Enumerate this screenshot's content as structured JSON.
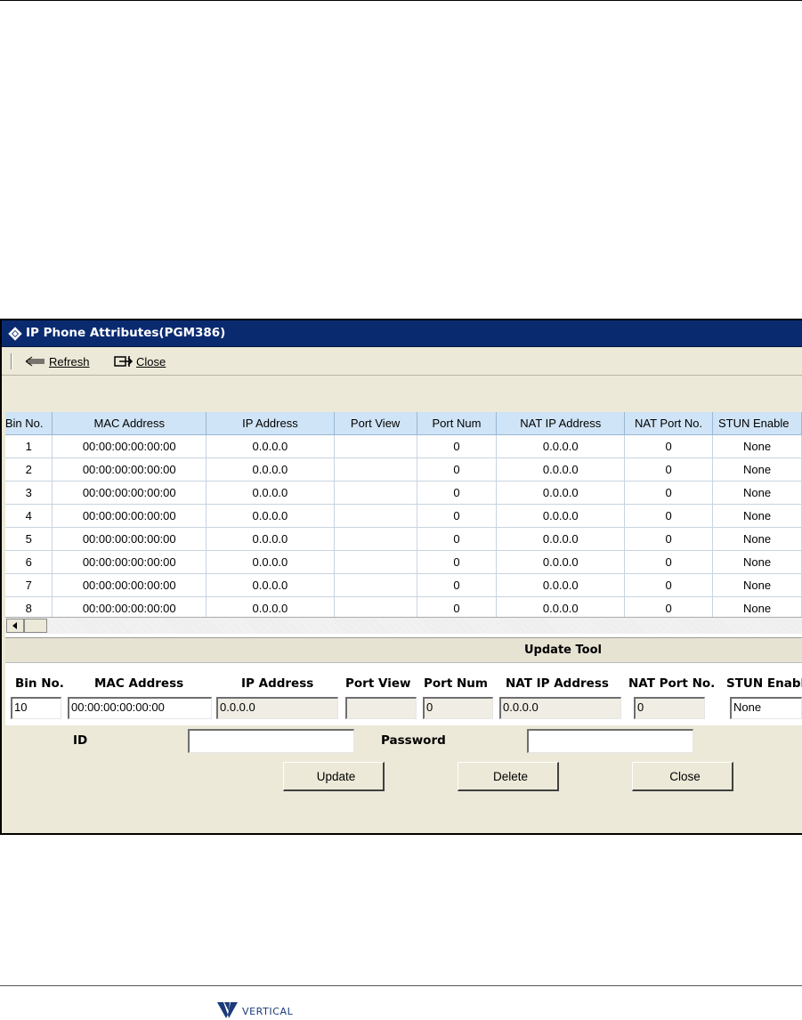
{
  "window": {
    "title": "IP Phone Attributes(PGM386)"
  },
  "toolbar": {
    "refresh_label": "Refresh",
    "close_label": "Close"
  },
  "table": {
    "columns": [
      "Bin No.",
      "MAC Address",
      "IP Address",
      "Port View",
      "Port Num",
      "NAT IP Address",
      "NAT Port No.",
      "STUN Enable"
    ],
    "rows": [
      [
        "1",
        "00:00:00:00:00:00",
        "0.0.0.0",
        "",
        "0",
        "0.0.0.0",
        "0",
        "None"
      ],
      [
        "2",
        "00:00:00:00:00:00",
        "0.0.0.0",
        "",
        "0",
        "0.0.0.0",
        "0",
        "None"
      ],
      [
        "3",
        "00:00:00:00:00:00",
        "0.0.0.0",
        "",
        "0",
        "0.0.0.0",
        "0",
        "None"
      ],
      [
        "4",
        "00:00:00:00:00:00",
        "0.0.0.0",
        "",
        "0",
        "0.0.0.0",
        "0",
        "None"
      ],
      [
        "5",
        "00:00:00:00:00:00",
        "0.0.0.0",
        "",
        "0",
        "0.0.0.0",
        "0",
        "None"
      ],
      [
        "6",
        "00:00:00:00:00:00",
        "0.0.0.0",
        "",
        "0",
        "0.0.0.0",
        "0",
        "None"
      ],
      [
        "7",
        "00:00:00:00:00:00",
        "0.0.0.0",
        "",
        "0",
        "0.0.0.0",
        "0",
        "None"
      ],
      [
        "8",
        "00:00:00:00:00:00",
        "0.0.0.0",
        "",
        "0",
        "0.0.0.0",
        "0",
        "None"
      ]
    ]
  },
  "update_tool": {
    "title": "Update Tool",
    "labels": {
      "bin_no": "Bin No.",
      "mac_address": "MAC Address",
      "ip_address": "IP Address",
      "port_view": "Port View",
      "port_num": "Port Num",
      "nat_ip_address": "NAT IP Address",
      "nat_port_no": "NAT Port No.",
      "stun_enable": "STUN Enable",
      "id": "ID",
      "password": "Password"
    },
    "values": {
      "bin_no": "10",
      "mac_address": "00:00:00:00:00:00",
      "ip_address": "0.0.0.0",
      "port_view": "",
      "port_num": "0",
      "nat_ip_address": "0.0.0.0",
      "nat_port_no": "0",
      "stun_enable": "None",
      "id": "",
      "password": ""
    },
    "buttons": {
      "update": "Update",
      "delete": "Delete",
      "close": "Close"
    }
  },
  "footer": {
    "logo_text": "VERTICAL"
  }
}
